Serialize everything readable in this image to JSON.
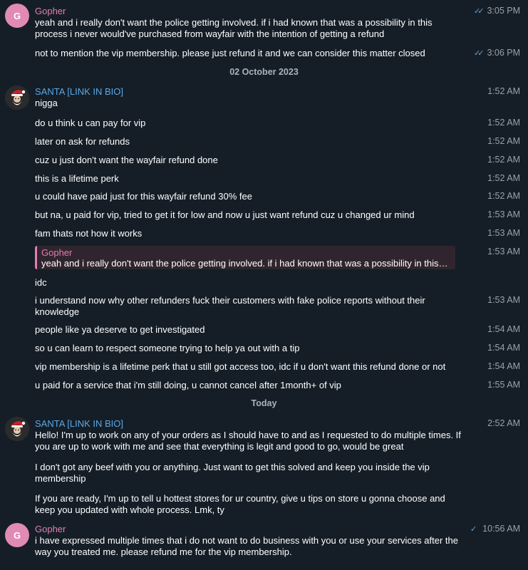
{
  "colors": {
    "background": "#151e27",
    "gopher_name": "#e27fb0",
    "santa_name": "#5aa8e6",
    "timestamp": "#98a2ab",
    "read_check": "#5aa8e6",
    "gopher_avatar": "#e08ab5"
  },
  "users": {
    "gopher": {
      "name": "Gopher",
      "initial": "G"
    },
    "santa": {
      "name": "SANTA [LINK IN BIO]",
      "avatar_icon": "santa-avatar-icon"
    }
  },
  "dates": {
    "first": "02 October 2023",
    "second": "Today"
  },
  "group1": {
    "messages": [
      {
        "text": "yeah and i really don't want the police getting involved. if i had known that was a possibility in this process i never would've purchased from wayfair with the intention of getting a refund",
        "time": "3:05 PM"
      },
      {
        "text": "not to mention the vip membership. please just refund it and we can consider this matter closed",
        "time": "3:06 PM"
      }
    ]
  },
  "group2": {
    "messages": [
      {
        "text": "nigga",
        "time": "1:52 AM"
      },
      {
        "text": "do u think u can pay for vip",
        "time": "1:52 AM"
      },
      {
        "text": "later on ask for refunds",
        "time": "1:52 AM"
      },
      {
        "text": "cuz u just don't want the wayfair refund done",
        "time": "1:52 AM"
      },
      {
        "text": "this is a lifetime perk",
        "time": "1:52 AM"
      },
      {
        "text": "u could have paid just for this wayfair refund 30% fee",
        "time": "1:52 AM"
      },
      {
        "text": "but na, u paid for vip, tried to get it for low and now u just want refund cuz u changed ur mind",
        "time": "1:53 AM"
      },
      {
        "text": "fam thats not how it works",
        "time": "1:53 AM"
      },
      {
        "text": "idc",
        "time": "1:53 AM"
      },
      {
        "text": "i understand now why other refunders fuck their customers with fake police reports without their knowledge",
        "time": "1:53 AM"
      },
      {
        "text": "people like ya deserve to get investigated",
        "time": "1:54 AM"
      },
      {
        "text": "so u can learn to respect someone trying to help ya out with a tip",
        "time": "1:54 AM"
      },
      {
        "text": "vip membership is a lifetime perk that u still got access too, idc if u don't want this refund done or not",
        "time": "1:54 AM"
      },
      {
        "text": "u paid for a service that i'm still doing, u cannot cancel after 1month+ of vip",
        "time": "1:55 AM"
      }
    ],
    "reply": {
      "name": "Gopher",
      "text": "yeah and i really don't want the police getting involved. if i had known that was a possibility in this pro..."
    }
  },
  "group3": {
    "time": "2:52 AM",
    "paragraphs": [
      "Hello! I'm up to work on any of your orders as I should have to and as I requested to do multiple times. If you are up to work with me and see that everything is legit and good to go, would be great",
      "I don't got any beef with you or anything. Just want to get this solved and keep you inside the vip membership",
      "If you are ready, I'm up to tell u hottest stores for ur country, give u tips on store u gonna choose and keep you updated with whole process. Lmk, ty"
    ]
  },
  "group4": {
    "time": "10:56 AM",
    "text": "i have expressed multiple times that i do not want to do business with you or use your services after the way you treated me. please refund me for the vip membership."
  }
}
